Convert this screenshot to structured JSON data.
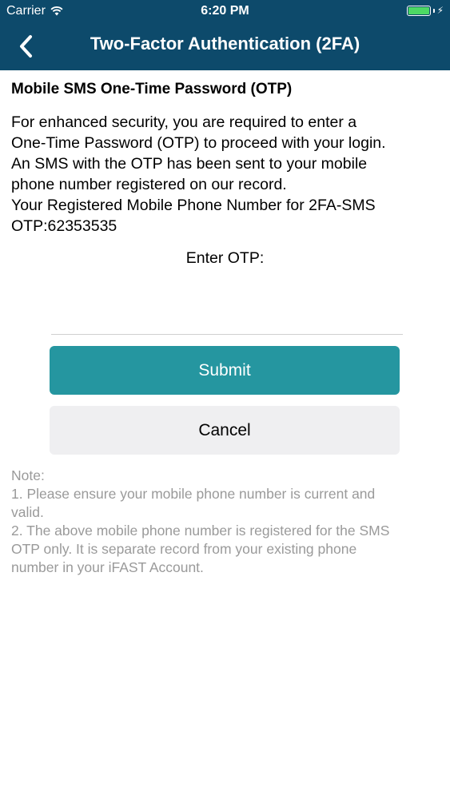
{
  "status_bar": {
    "carrier": "Carrier",
    "time": "6:20 PM",
    "battery_level": 1.0,
    "battery_color": "#4cd964",
    "wifi_icon": "wifi-icon",
    "charging_icon": "bolt-icon"
  },
  "nav": {
    "title": "Two-Factor Authentication (2FA)",
    "back_icon": "chevron-left-icon",
    "background_color": "#0d4a6b"
  },
  "main": {
    "section_title": "Mobile SMS One-Time Password (OTP)",
    "description_lines": [
      "For enhanced security, you are required to enter a",
      "One-Time Password (OTP) to proceed with your login.",
      "An SMS with the OTP has been sent to your mobile",
      "phone number registered on our record.",
      "Your Registered Mobile Phone Number for 2FA-SMS",
      "OTP:62353535"
    ],
    "otp_label": "Enter OTP:",
    "otp_value": "",
    "submit_label": "Submit",
    "submit_color": "#2596a0",
    "cancel_label": "Cancel"
  },
  "note": {
    "lines": [
      "Note:",
      "1. Please ensure your mobile phone number is current and",
      "valid.",
      "2. The above mobile phone number is registered for the SMS",
      "OTP only. It is separate record from your existing phone",
      "number in your iFAST Account."
    ]
  }
}
